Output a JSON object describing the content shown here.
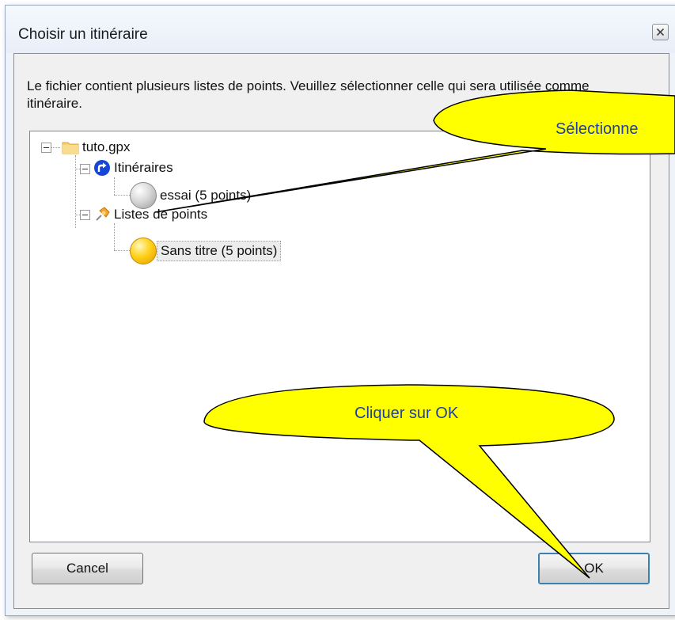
{
  "dialog": {
    "title": "Choisir un itinéraire",
    "close_icon": "close-icon",
    "instructions": "Le fichier contient plusieurs listes de points. Veuillez sélectionner celle qui sera utilisée comme itinéraire."
  },
  "tree": {
    "root": {
      "label": "tuto.gpx",
      "icon": "folder-icon"
    },
    "groups": [
      {
        "label": "Itinéraires",
        "icon": "route-icon",
        "children": [
          {
            "label": "essai (5 points)",
            "icon": "gray-sphere-icon"
          }
        ]
      },
      {
        "label": "Listes de points",
        "icon": "pin-icon",
        "children": [
          {
            "label": "Sans titre (5 points)",
            "icon": "yellow-sphere-icon",
            "selected": true
          }
        ]
      }
    ]
  },
  "buttons": {
    "cancel": "Cancel",
    "ok": "OK"
  },
  "callouts": {
    "top": "Sélectionne",
    "bottom": "Cliquer sur OK",
    "fill": "#ffff00"
  }
}
